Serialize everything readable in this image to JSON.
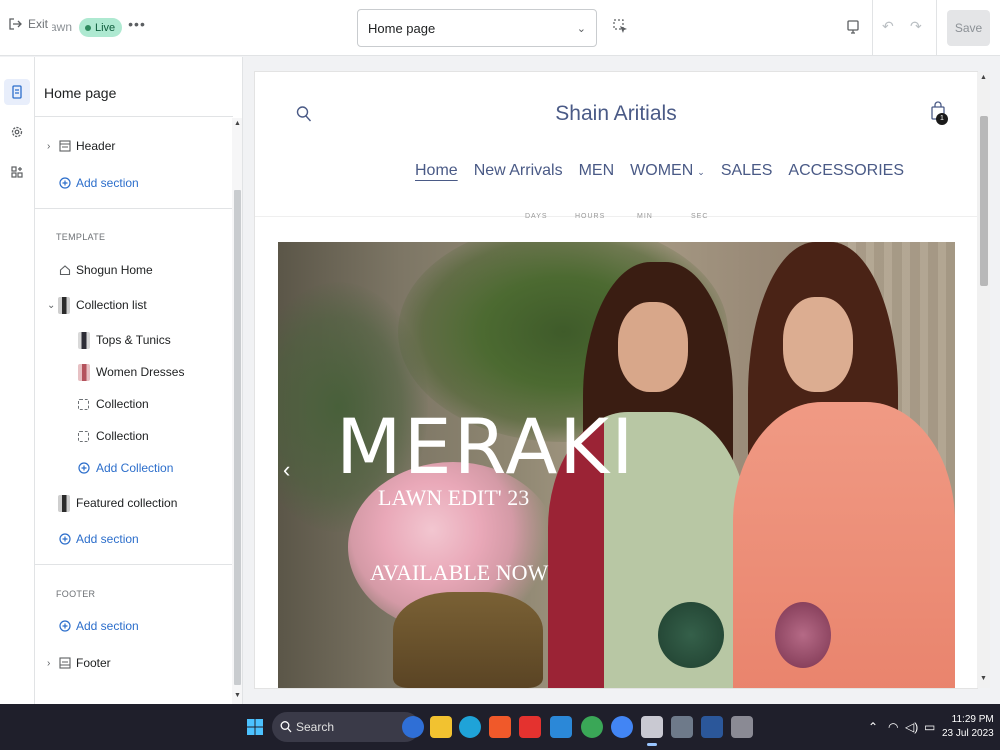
{
  "topbar": {
    "exit_label": "Exit",
    "theme_name_fragment": "awn",
    "live_label": "Live",
    "page_select_value": "Home page",
    "save_label": "Save"
  },
  "sidebar": {
    "title": "Home page",
    "header_section": "Header",
    "add_section": "Add section",
    "template_heading": "TEMPLATE",
    "shogun_home": "Shogun Home",
    "collection_list": "Collection list",
    "collections": [
      "Tops & Tunics",
      "Women Dresses",
      "Collection",
      "Collection"
    ],
    "add_collection": "Add Collection",
    "featured_collection": "Featured collection",
    "footer_heading": "FOOTER",
    "footer_section": "Footer"
  },
  "store": {
    "title": "Shain Aritials",
    "cart_count": "1",
    "nav": [
      "Home",
      "New Arrivals",
      "MEN",
      "WOMEN",
      "SALES",
      "ACCESSORIES"
    ],
    "countdown": [
      "DAYS",
      "HOURS",
      "MIN",
      "SEC"
    ],
    "hero_title": "MERAKI",
    "hero_subtitle": "LAWN EDIT' 23",
    "hero_cta": "AVAILABLE NOW"
  },
  "taskbar": {
    "search_label": "Search",
    "time": "11:29 PM",
    "date": "23 Jul 2023"
  },
  "colors": {
    "accent": "#2c6ecb",
    "live_badge": "#aee9d1",
    "store_text": "#4a5a86",
    "taskbar": "#1f1f2b"
  }
}
